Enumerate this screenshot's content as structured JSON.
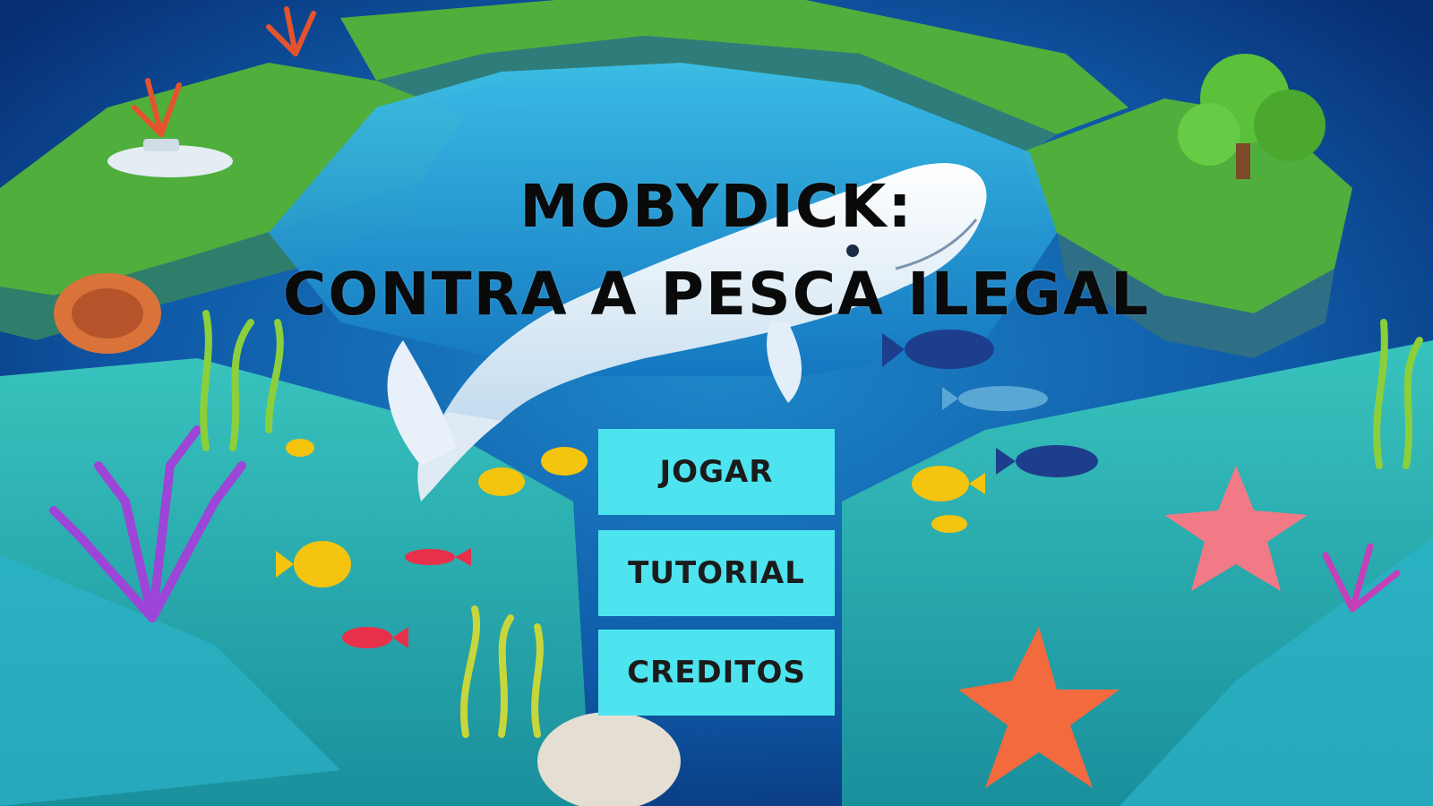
{
  "game": {
    "title_line_1": "MOBYDICK:",
    "title_line_2": "CONTRA A PESCA ILEGAL"
  },
  "menu": {
    "buttons": [
      {
        "label": "JOGAR"
      },
      {
        "label": "TUTORIAL"
      },
      {
        "label": "CREDITOS"
      }
    ]
  },
  "colors": {
    "button_fill": "#4ee4ef",
    "title_text": "#0a0a0a",
    "ocean_deep": "#0b3d8a",
    "ocean_light": "#2aa3d6",
    "grass": "#4fae3c",
    "seafloor": "#2fb6b0"
  },
  "scene": {
    "elements": [
      "white-whale",
      "floating-island-left",
      "floating-island-right",
      "floating-island-top",
      "coral-reef",
      "tropical-fish",
      "submarine",
      "starfish"
    ]
  }
}
